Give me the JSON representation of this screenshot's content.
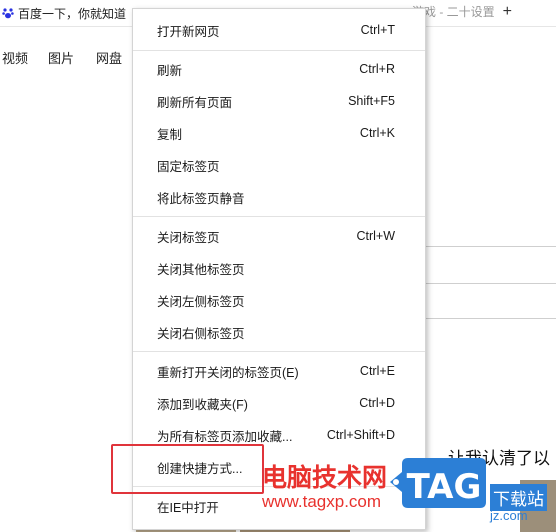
{
  "browser": {
    "tab_title": "百度一下，你就知道",
    "tab2_title": "游戏 - 二十设置",
    "new_tab_symbol": "+",
    "nav": [
      "视频",
      "图片",
      "网盘"
    ],
    "article_snippet": "让我认清了以"
  },
  "context_menu": {
    "items": [
      {
        "label": "打开新网页",
        "shortcut": "Ctrl+T"
      },
      {
        "label": "刷新",
        "shortcut": "Ctrl+R"
      },
      {
        "label": "刷新所有页面",
        "shortcut": "Shift+F5"
      },
      {
        "label": "复制",
        "shortcut": "Ctrl+K"
      },
      {
        "label": "固定标签页",
        "shortcut": ""
      },
      {
        "label": "将此标签页静音",
        "shortcut": ""
      },
      {
        "label": "关闭标签页",
        "shortcut": "Ctrl+W"
      },
      {
        "label": "关闭其他标签页",
        "shortcut": ""
      },
      {
        "label": "关闭左侧标签页",
        "shortcut": ""
      },
      {
        "label": "关闭右侧标签页",
        "shortcut": ""
      },
      {
        "label": "重新打开关闭的标签页(E)",
        "shortcut": "Ctrl+E"
      },
      {
        "label": "添加到收藏夹(F)",
        "shortcut": "Ctrl+D"
      },
      {
        "label": "为所有标签页添加收藏...",
        "shortcut": "Ctrl+Shift+D"
      },
      {
        "label": "创建快捷方式...",
        "shortcut": ""
      },
      {
        "label": "在IE中打开",
        "shortcut": ""
      }
    ]
  },
  "watermark": {
    "site_name": "电脑技术网",
    "url": "www.tagxp.com",
    "logo_text": "TAG",
    "download_text": "下载站",
    "download_sub": "jz.com"
  },
  "colors": {
    "highlight_box": "#e0343b",
    "watermark_red": "#e8322e",
    "logo_blue": "#2c7fd6"
  }
}
